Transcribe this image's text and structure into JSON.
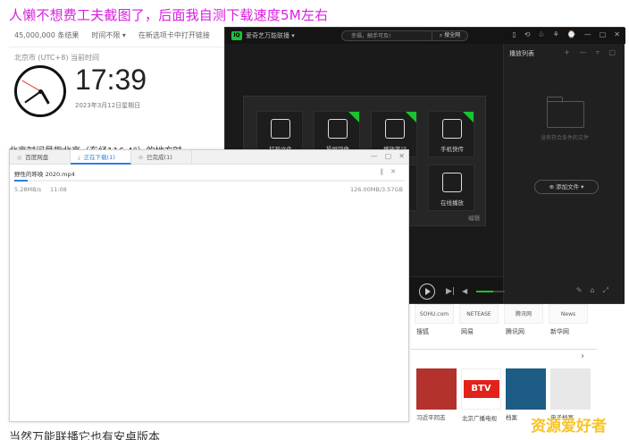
{
  "headline": "人懒不想费工夫截图了，后面我自测下载速度5M左右",
  "search": {
    "result_count": "45,000,000 条结果",
    "time_filter": "时间不限 ▾",
    "open_new_tab": "在新选项卡中打开链接",
    "location_label": "北京市 (UTC+8) 当前时间",
    "time": "17:39",
    "date": "2023年3月12日星期日",
    "partial_text": "北京时间是指北京（东经116.4°）的地方时..."
  },
  "player": {
    "app_name": "爱奇艺万能联播 ▾",
    "search_placeholder": "幸福，触手可及!",
    "search_button": "⌕ 搜全网",
    "window_controls": [
      "▯",
      "⟲",
      "♧",
      "⚘",
      "⌚",
      "—",
      "▢",
      "✕"
    ],
    "playlist_title": "播放列表",
    "playlist_tools": "+ — ▿ ▢",
    "playlist_empty": "没有符合条件的文件",
    "add_file": "⊕ 添加文件 ▾",
    "tiles": [
      {
        "label": "打开文件",
        "badge": false
      },
      {
        "label": "投屏镜像",
        "badge": true
      },
      {
        "label": "播放笔记",
        "badge": true
      },
      {
        "label": "手机快传",
        "badge": true
      },
      {
        "label": "",
        "badge": false
      },
      {
        "label": "在线播放",
        "badge": false
      }
    ],
    "edit_label": "编辑",
    "volume_level": 0.6
  },
  "sites": [
    {
      "logo": "SOHU.com",
      "label": "搜狐"
    },
    {
      "logo": "NETEASE",
      "label": "网易"
    },
    {
      "logo": "腾讯网",
      "label": "腾讯网"
    },
    {
      "logo": "News",
      "label": "新华网"
    }
  ],
  "news": [
    {
      "caption": "习近平同志",
      "kind": "photo"
    },
    {
      "caption": "北京广播电视",
      "kind": "btv",
      "logo": "BTV"
    },
    {
      "caption": "档案",
      "kind": "poster"
    },
    {
      "caption": "电子档案",
      "kind": "doc"
    }
  ],
  "download": {
    "tabs": [
      {
        "label": "百度网盘",
        "active": false
      },
      {
        "label": "正在下载(1)",
        "active": true
      },
      {
        "label": "已完成(1)",
        "active": false
      }
    ],
    "window_controls": [
      "—",
      "▢",
      "✕"
    ],
    "file_name": "野性的呼唤 2020.mp4",
    "speed": "5.28MB/s",
    "eta": "11:08",
    "size": "126.00MB/3.57GB",
    "progress": 0.034
  },
  "bottom_text": "当然万能联播它也有安卓版本",
  "watermark": "资源爱好者",
  "colors": {
    "accent_green": "#19c332",
    "download_blue": "#2f7fe0",
    "headline_magenta": "#d81ee0"
  }
}
